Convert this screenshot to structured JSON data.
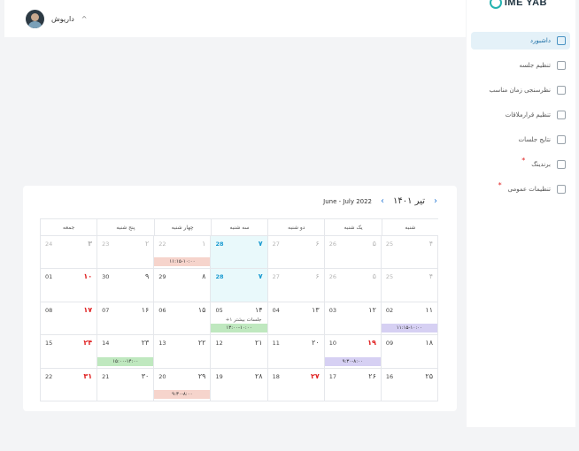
{
  "header": {
    "user_name": "داریوش",
    "chevron": "^"
  },
  "sidebar": {
    "logo": "IME YAB",
    "items": [
      {
        "label": "داشبورد",
        "icon": "grid-icon",
        "active": true,
        "starred": false
      },
      {
        "label": "تنظیم جلسه",
        "icon": "clipboard-icon",
        "active": false,
        "starred": false
      },
      {
        "label": "نظرسنجی زمان مناسب",
        "icon": "clipboard-check-icon",
        "active": false,
        "starred": false
      },
      {
        "label": "تنظیم قرارملاقات",
        "icon": "users-icon",
        "active": false,
        "starred": false
      },
      {
        "label": "نتایج جلسات",
        "icon": "document-icon",
        "active": false,
        "starred": false
      },
      {
        "label": "برندینگ",
        "icon": "brand-icon",
        "active": false,
        "starred": true
      },
      {
        "label": "تنظیمات عمومی",
        "icon": "gear-icon",
        "active": false,
        "starred": true
      }
    ]
  },
  "calendar": {
    "title_fa": "تیر ۱۴۰۱",
    "title_en": "June - July 2022",
    "days_of_week": [
      "شنبه",
      "یک شنبه",
      "دو شنبه",
      "سه شنبه",
      "چهار شنبه",
      "پنج شنبه",
      "جمعه"
    ],
    "weeks": [
      [
        {
          "fa": "۴",
          "en": "25",
          "muted": true
        },
        {
          "fa": "۵",
          "en": "26",
          "muted": true
        },
        {
          "fa": "۶",
          "en": "27",
          "muted": true
        },
        {
          "fa": "۷",
          "en": "28",
          "today": true
        },
        {
          "fa": "۱",
          "en": "22",
          "muted": true,
          "event": {
            "text": "۱۱:۱۵-۱۰:۰۰",
            "color": "pink"
          }
        },
        {
          "fa": "۲",
          "en": "23",
          "muted": true
        },
        {
          "fa": "۳",
          "en": "24",
          "muted": true,
          "red": true
        }
      ],
      [
        {
          "fa": "۴",
          "en": "25",
          "muted": true
        },
        {
          "fa": "۵",
          "en": "26",
          "muted": true
        },
        {
          "fa": "۶",
          "en": "27",
          "muted": true
        },
        {
          "fa": "۷",
          "en": "28",
          "today": true
        },
        {
          "fa": "۸",
          "en": "29"
        },
        {
          "fa": "۹",
          "en": "30"
        },
        {
          "fa": "۱۰",
          "en": "01",
          "red": true
        }
      ],
      [
        {
          "fa": "۱۱",
          "en": "02",
          "event": {
            "text": "۱۱:۱۵-۱۰:۰۰",
            "color": "purple"
          }
        },
        {
          "fa": "۱۲",
          "en": "03"
        },
        {
          "fa": "۱۳",
          "en": "04"
        },
        {
          "fa": "۱۴",
          "en": "05",
          "more": "+۱ جلسات بیشتر",
          "event": {
            "text": "۱۳:۰۰-۱۰:۰۰",
            "color": "green"
          }
        },
        {
          "fa": "۱۵",
          "en": "06"
        },
        {
          "fa": "۱۶",
          "en": "07"
        },
        {
          "fa": "۱۷",
          "en": "08",
          "red": true
        }
      ],
      [
        {
          "fa": "۱۸",
          "en": "09"
        },
        {
          "fa": "۱۹",
          "en": "10",
          "red": true,
          "event": {
            "text": "۹:۳۰-۸:۰۰",
            "color": "purple"
          }
        },
        {
          "fa": "۲۰",
          "en": "11"
        },
        {
          "fa": "۲۱",
          "en": "12"
        },
        {
          "fa": "۲۲",
          "en": "13"
        },
        {
          "fa": "۲۳",
          "en": "14",
          "event": {
            "text": "۱۵:۰۰-۱۴:۰۰",
            "color": "green"
          }
        },
        {
          "fa": "۲۴",
          "en": "15",
          "red": true
        }
      ],
      [
        {
          "fa": "۲۵",
          "en": "16"
        },
        {
          "fa": "۲۶",
          "en": "17"
        },
        {
          "fa": "۲۷",
          "en": "18",
          "red": true
        },
        {
          "fa": "۲۸",
          "en": "19"
        },
        {
          "fa": "۲۹",
          "en": "20",
          "event": {
            "text": "۹:۳۰-۸:۰۰",
            "color": "pink"
          }
        },
        {
          "fa": "۳۰",
          "en": "21"
        },
        {
          "fa": "۳۱",
          "en": "22",
          "red": true
        }
      ]
    ]
  }
}
